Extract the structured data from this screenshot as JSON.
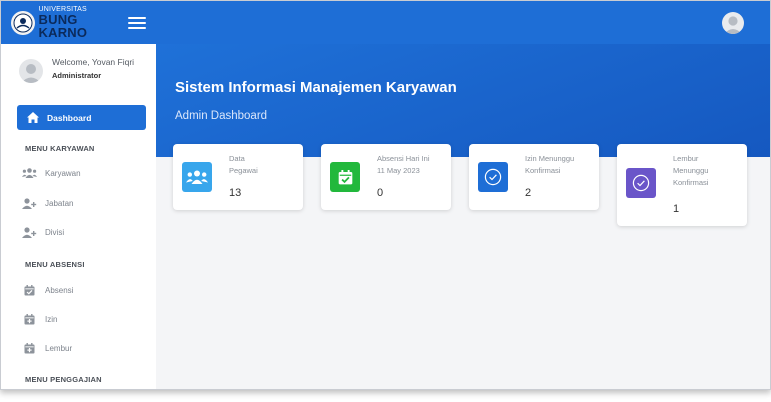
{
  "brand": {
    "line1": "UNIVERSITAS",
    "line2": "BUNG KARNO"
  },
  "profile": {
    "welcome": "Welcome, Yovan Fiqri",
    "role": "Administrator"
  },
  "sidebar": {
    "active": "Dashboard",
    "sections": [
      {
        "title": "MENU KARYAWAN",
        "items": [
          "Karyawan",
          "Jabatan",
          "Divisi"
        ]
      },
      {
        "title": "MENU ABSENSI",
        "items": [
          "Absensi",
          "Izin",
          "Lembur"
        ]
      },
      {
        "title": "MENU PENGGAJIAN",
        "items": []
      }
    ]
  },
  "header": {
    "title": "Sistem Informasi Manajemen Karyawan",
    "subtitle": "Admin Dashboard"
  },
  "cards": [
    {
      "label_lines": [
        "Data",
        "Pegawai"
      ],
      "value": "13",
      "icon": "users-icon",
      "color": "#38a6ec"
    },
    {
      "label_lines": [
        "Absensi Hari Ini",
        "11 May 2023"
      ],
      "value": "0",
      "icon": "calendar-check-icon",
      "color": "#22b83c"
    },
    {
      "label_lines": [
        "Izin Menunggu",
        "Konfirmasi"
      ],
      "value": "2",
      "icon": "check-circle-icon",
      "color": "#1e6ed6"
    },
    {
      "label_lines": [
        "Lembur",
        "Menunggu",
        "Konfirmasi"
      ],
      "value": "1",
      "icon": "check-circle-icon",
      "color": "#6a55c9"
    }
  ],
  "colors": {
    "primary": "#1e6ed6",
    "sidebar_bg": "#ffffff",
    "content_bg": "#f4f5f7"
  }
}
